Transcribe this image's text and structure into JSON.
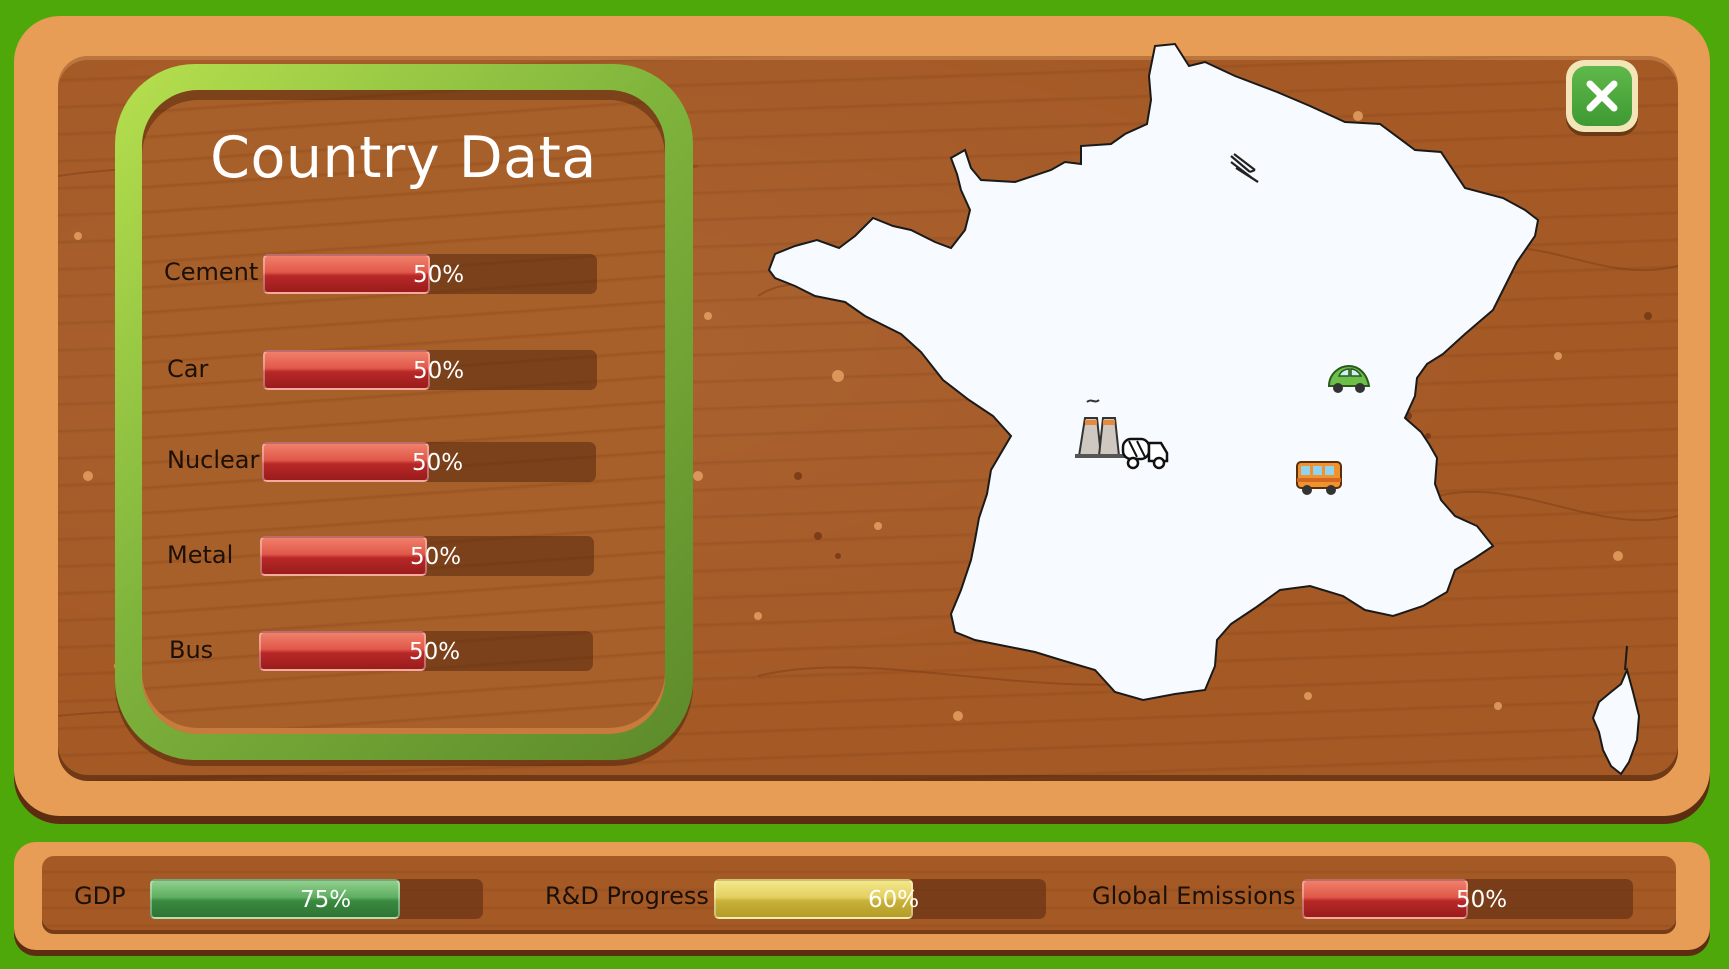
{
  "panel": {
    "title": "Country Data",
    "sectors": [
      {
        "label": "Cement",
        "percent": 50,
        "text": "50%"
      },
      {
        "label": "Car",
        "percent": 50,
        "text": "50%"
      },
      {
        "label": "Nuclear",
        "percent": 50,
        "text": "50%"
      },
      {
        "label": "Metal",
        "percent": 50,
        "text": "50%"
      },
      {
        "label": "Bus",
        "percent": 50,
        "text": "50%"
      }
    ]
  },
  "status": {
    "gdp": {
      "label": "GDP",
      "percent": 75,
      "text": "75%"
    },
    "rnd": {
      "label": "R&D Progress",
      "percent": 60,
      "text": "60%"
    },
    "emissions": {
      "label": "Global Emissions",
      "percent": 50,
      "text": "50%"
    }
  },
  "map": {
    "icons": [
      "metal-beams-icon",
      "nuclear-plant-icon",
      "cement-truck-icon",
      "car-icon",
      "bus-icon"
    ]
  },
  "colors": {
    "grass": "#4fa80a",
    "wood": "#a55a26",
    "frame_green": "#8cc540",
    "bar_red": "#c8302c",
    "bar_green": "#4f9e52",
    "bar_yellow": "#d8c24c",
    "map_fill": "#f7fbff"
  }
}
